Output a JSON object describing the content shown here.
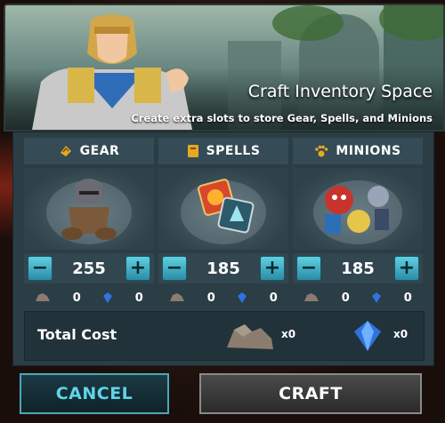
{
  "banner": {
    "title": "Craft Inventory Space",
    "subtitle": "Create extra slots to store Gear, Spells, and Minions"
  },
  "columns": [
    {
      "label": "GEAR",
      "icon": "gear-category-icon",
      "quantity": "255",
      "rocks": "0",
      "gems": "0"
    },
    {
      "label": "SPELLS",
      "icon": "spellbook-icon",
      "quantity": "185",
      "rocks": "0",
      "gems": "0"
    },
    {
      "label": "MINIONS",
      "icon": "paw-icon",
      "quantity": "185",
      "rocks": "0",
      "gems": "0"
    }
  ],
  "total": {
    "label": "Total Cost",
    "rocks": "x0",
    "gems": "x0"
  },
  "buttons": {
    "cancel": "CANCEL",
    "craft": "CRAFT",
    "minus": "−",
    "plus": "+"
  },
  "colors": {
    "accent": "#4fc3d9",
    "panel": "#2b3d45"
  }
}
